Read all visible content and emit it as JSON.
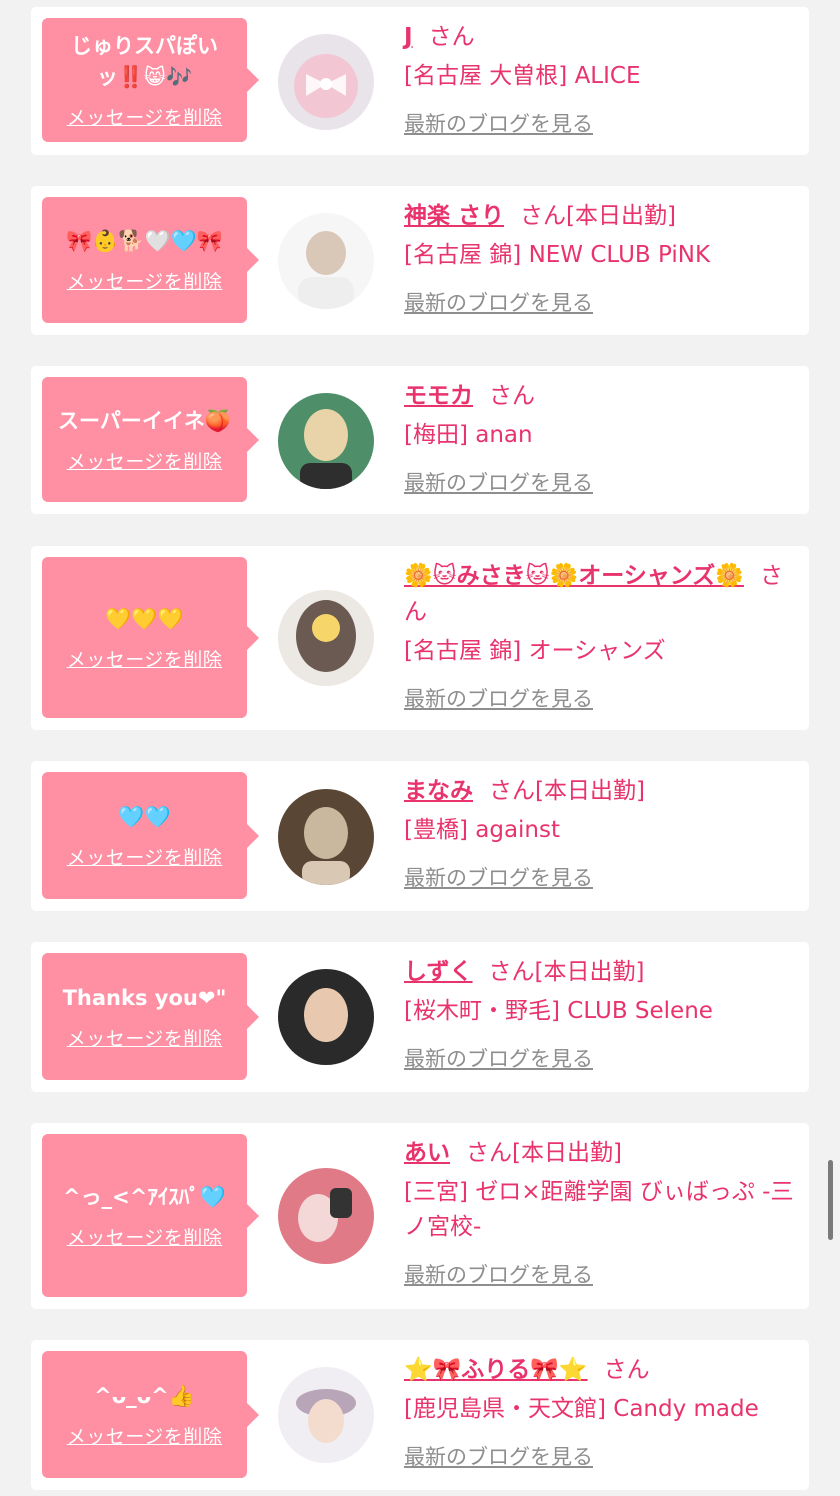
{
  "delete_label": "メッセージを削除",
  "blog_label": "最新のブログを見る",
  "honorific": "さん",
  "colors": {
    "bubble": "#ff8fa3",
    "accent": "#e8336d",
    "link_gray": "#8e8e8e",
    "background": "#f2f2f2"
  },
  "entries": [
    {
      "message": "じゅりスパぽいッ‼️😸🎶",
      "name": "J",
      "status": "",
      "shop": "[名古屋 大曽根] ALICE",
      "avatar_icon": "bow-photo-icon",
      "avatar_colors": [
        "#e9e4ea",
        "#f3c6d4"
      ]
    },
    {
      "message": "🎀👶🐕🤍🩵🎀",
      "name": "神楽 さり",
      "status": "[本日出勤]",
      "shop": "[名古屋 錦] NEW CLUB PiNK",
      "avatar_icon": "portrait-photo-icon",
      "avatar_colors": [
        "#f6f6f6",
        "#d9c7b8"
      ]
    },
    {
      "message": "スーパーイイネ🍑",
      "name": "モモカ",
      "status": "",
      "shop": "[梅田] anan",
      "avatar_icon": "portrait-photo-icon",
      "avatar_colors": [
        "#e9d3a8",
        "#4e8f6a"
      ]
    },
    {
      "message": "💛💛💛",
      "name": "🌼🐱みさき🐱🌼オーシャンズ🌼",
      "status": "",
      "shop": "[名古屋 錦] オーシャンズ",
      "avatar_icon": "portrait-photo-icon",
      "avatar_colors": [
        "#ece8e4",
        "#6a5a52"
      ]
    },
    {
      "message": "🩵🩵",
      "name": "まなみ",
      "status": "[本日出勤]",
      "shop": "[豊橋] against",
      "avatar_icon": "portrait-photo-icon",
      "avatar_colors": [
        "#c9b79e",
        "#5a4634"
      ]
    },
    {
      "message": "Thanks you❤\"",
      "name": "しずく",
      "status": "[本日出勤]",
      "shop": "[桜木町・野毛] CLUB Selene",
      "avatar_icon": "portrait-photo-icon",
      "avatar_colors": [
        "#2a2a2a",
        "#e8c9b0"
      ]
    },
    {
      "message": "^っ_<^ｱｲｽﾊﾟ🩵",
      "name": "あい",
      "status": "[本日出勤]",
      "shop": "[三宮] ゼロ×距離学園 びぃばっぷ -三ノ宮校-",
      "avatar_icon": "portrait-photo-icon",
      "avatar_colors": [
        "#e07a86",
        "#f4d8d8"
      ]
    },
    {
      "message": "^ᴗ_ᴗ^👍",
      "name": "⭐🎀ふりる🎀⭐",
      "status": "",
      "shop": "[鹿児島県・天文館] Candy made",
      "avatar_icon": "portrait-photo-icon",
      "avatar_colors": [
        "#f0eef2",
        "#b8a6b8"
      ]
    }
  ]
}
